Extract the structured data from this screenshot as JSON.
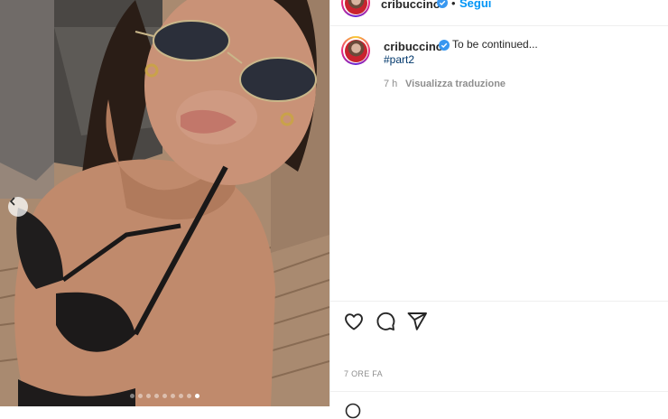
{
  "post": {
    "username": "cribuccino",
    "separator": "•",
    "follow_label": "Segui",
    "caption": "To be continued...",
    "hashtag": "#part2",
    "caption_time": "7 h",
    "translate_label": "Visualizza traduzione",
    "posted_ago": "7 ORE FA"
  },
  "carousel": {
    "total_slides": 9,
    "current_slide": 9
  },
  "icons": {
    "verified": "verified-badge-icon",
    "like": "heart-icon",
    "comment": "comment-icon",
    "share": "paper-plane-icon",
    "prev": "chevron-left-icon"
  },
  "colors": {
    "link_blue": "#0095f6",
    "verified_blue": "#3897f0",
    "muted": "#8e8e8e"
  }
}
